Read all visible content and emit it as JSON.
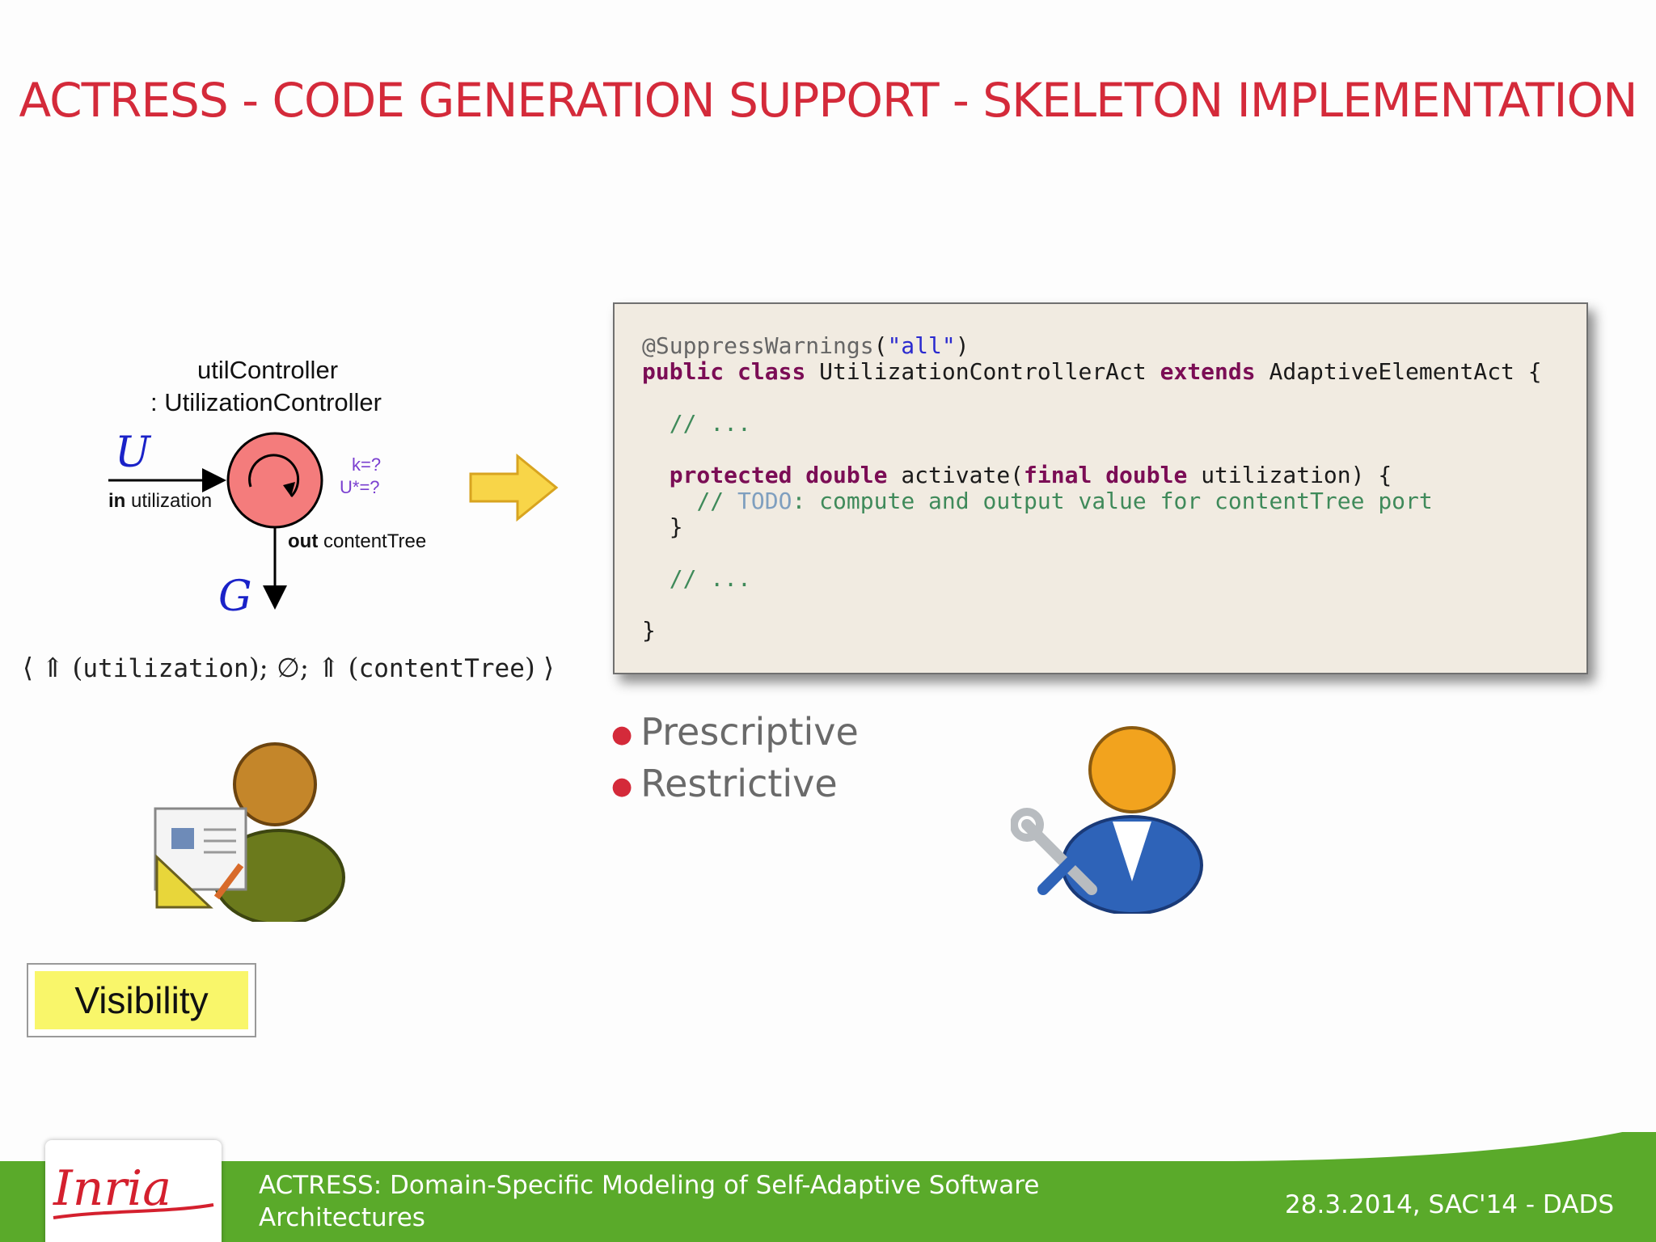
{
  "title": "ACTRESS - CODE GENERATION SUPPORT - SKELETON IMPLEMENTATION",
  "diagram": {
    "instance_name": "utilController",
    "type_name": ": UtilizationController",
    "input_var": "U",
    "output_var": "G",
    "in_keyword": "in",
    "in_port": "utilization",
    "out_keyword": "out",
    "out_port": "contentTree",
    "param_k": "k=?",
    "param_u": "U*=?"
  },
  "signature": {
    "open": "⟨ ⇑ (",
    "in_port": "utilization",
    "middle": "); ∅; ⇑ (",
    "out_port": "contentTree",
    "close": ") ⟩"
  },
  "code": {
    "annotation": "@SuppressWarnings",
    "annotation_arg": "\"all\"",
    "kw_public": "public",
    "kw_class": "class",
    "class_name": "UtilizationControllerAct",
    "kw_extends": "extends",
    "super_name": "AdaptiveElementAct",
    "comment_dots": "// ...",
    "kw_protected": "protected",
    "kw_double": "double",
    "method_name": "activate",
    "kw_final": "final",
    "param_name": "utilization",
    "todo_prefix": "// ",
    "todo_word": "TODO",
    "todo_text": ": compute and output value for contentTree port"
  },
  "bullets": [
    "Prescriptive",
    "Restrictive"
  ],
  "visibility_label": "Visibility",
  "footer": {
    "logo_text": "Inria",
    "subtitle": "ACTRESS: Domain-Specific Modeling of Self-Adaptive Software Architectures",
    "date_venue": "28.3.2014, SAC'14 - DADS"
  },
  "colors": {
    "title_red": "#d42a3a",
    "footer_green": "#5aaa2a",
    "component_fill": "#f47c7c",
    "arrow_yellow": "#f8d548",
    "highlight_yellow": "#f9f66a"
  },
  "icons": [
    "designer-person-icon",
    "developer-person-icon",
    "right-arrow-icon"
  ]
}
